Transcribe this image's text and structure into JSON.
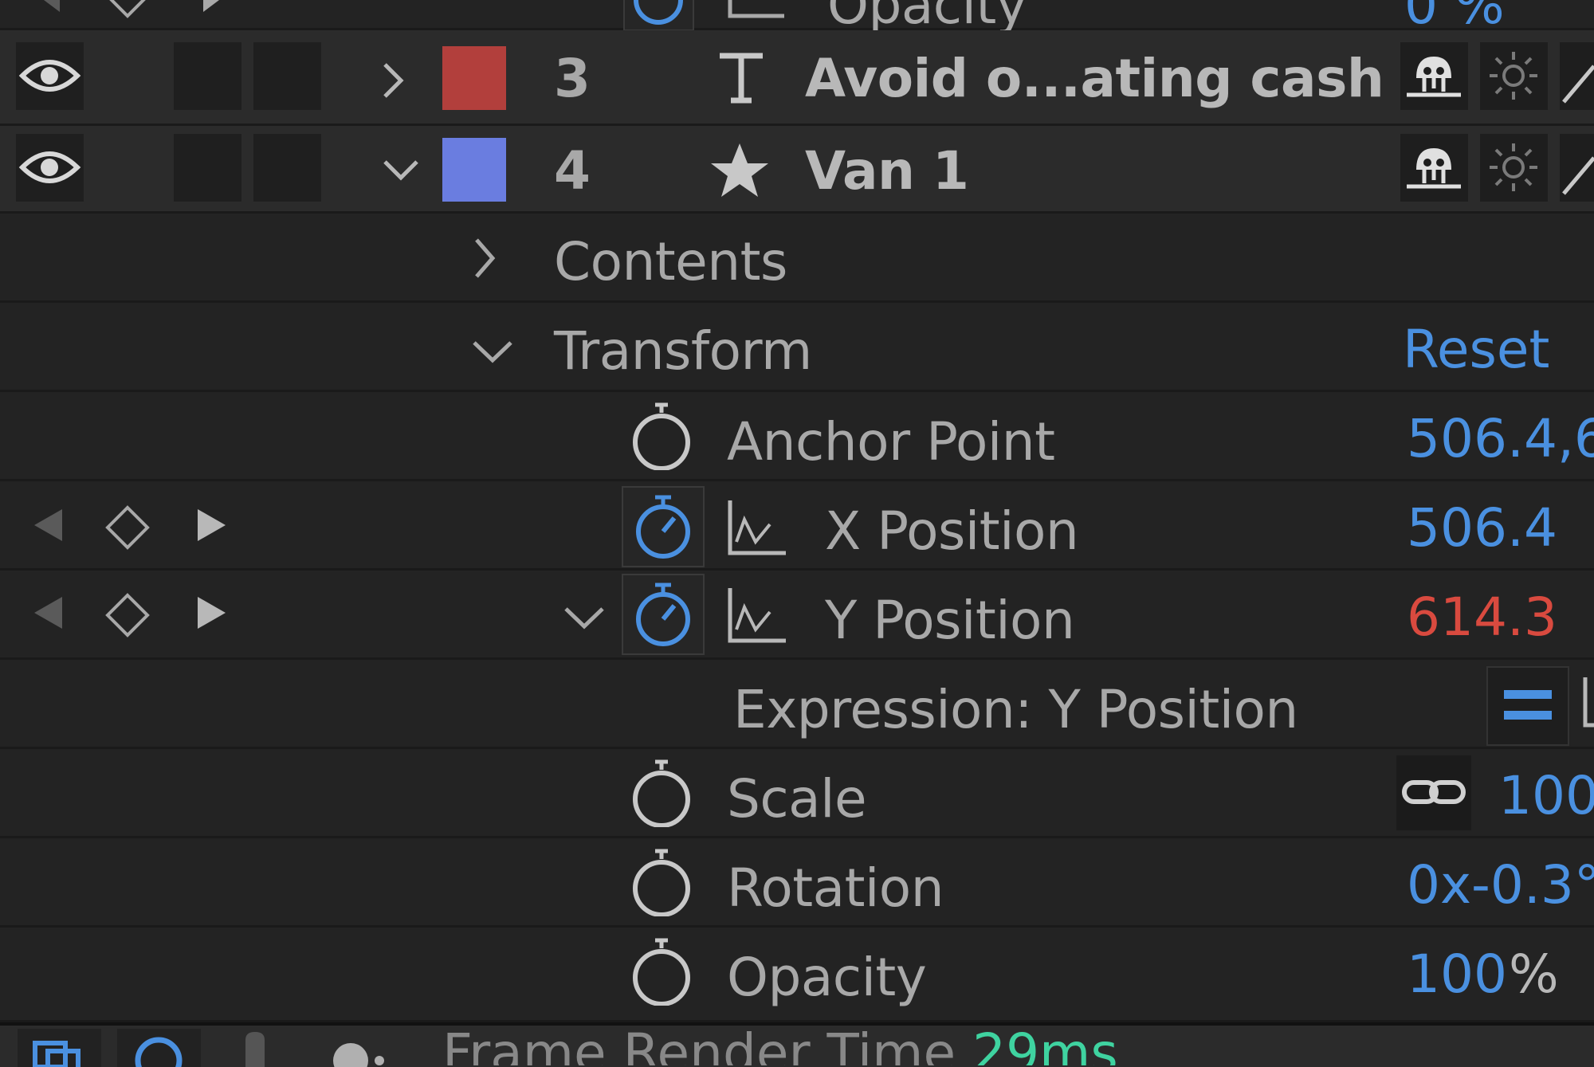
{
  "top_row": {
    "label": "Opacity",
    "value": "0 %"
  },
  "layers": [
    {
      "number": "3",
      "type_icon": "text-layer-icon",
      "name": "Avoid o...ating cash",
      "color": "#b23f3c"
    },
    {
      "number": "4",
      "type_icon": "shape-star-icon",
      "name": "Van 1",
      "color": "#6a7de0"
    }
  ],
  "groups": {
    "contents": "Contents",
    "transform": "Transform",
    "reset": "Reset"
  },
  "properties": {
    "anchor_point": {
      "label": "Anchor Point",
      "value": "506.4,6"
    },
    "x_position": {
      "label": "X Position",
      "value": "506.4"
    },
    "y_position": {
      "label": "Y Position",
      "value": "614.3"
    },
    "expression": {
      "label": "Expression: Y Position"
    },
    "scale": {
      "label": "Scale",
      "value": "100"
    },
    "rotation": {
      "label": "Rotation",
      "value": "0x-0.3°"
    },
    "opacity": {
      "label": "Opacity",
      "value": "100",
      "unit": "%"
    }
  },
  "status_bar": {
    "label": "Frame Render Time",
    "value": "29ms"
  },
  "colors": {
    "accent_blue": "#4a90e0",
    "expression_red": "#d94a3f",
    "render_time_green": "#3fd3a0"
  }
}
